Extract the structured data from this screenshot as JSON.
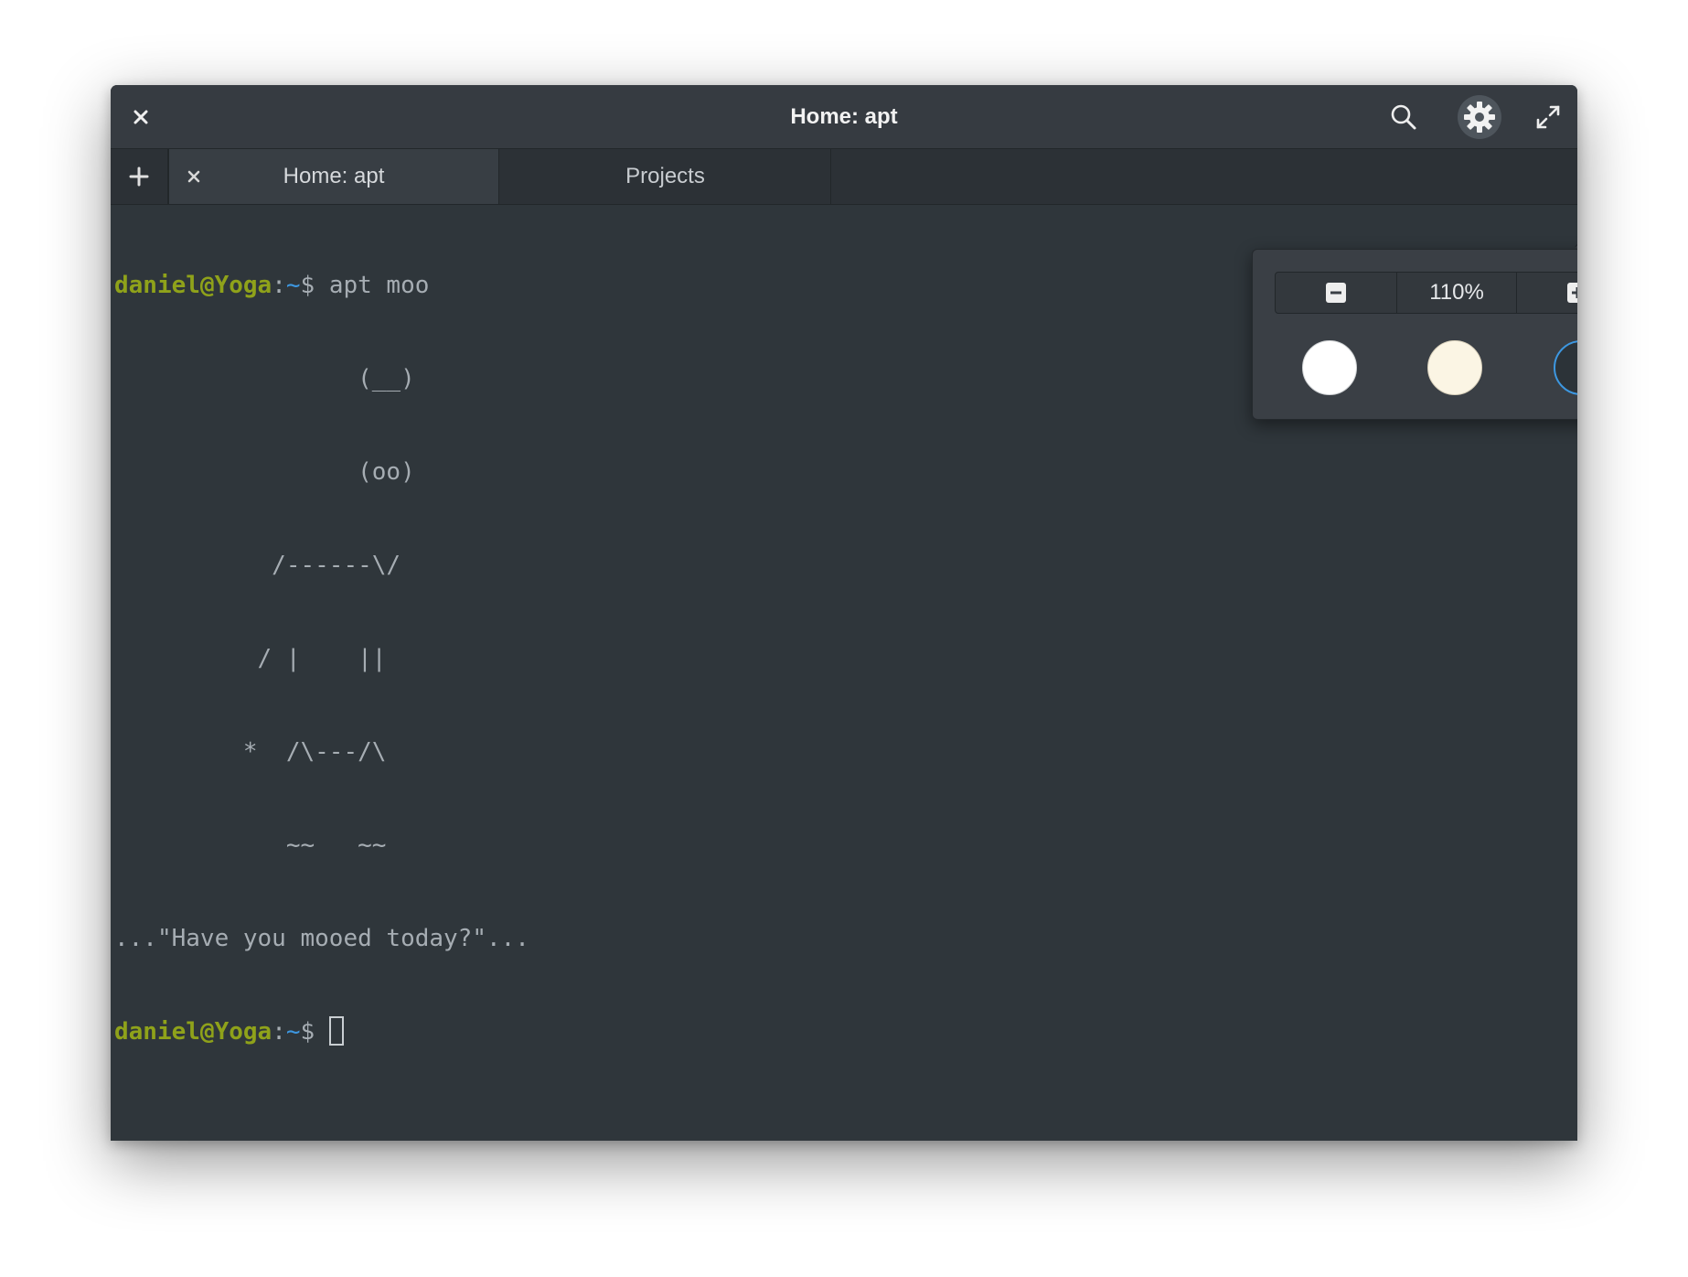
{
  "window": {
    "title": "Home: apt"
  },
  "titlebar": {
    "close_icon": "close-icon",
    "search_icon": "search-icon",
    "settings_icon": "gear-icon",
    "fullscreen_icon": "fullscreen-icon"
  },
  "tabs": [
    {
      "label": "Home: apt",
      "active": true
    },
    {
      "label": "Projects",
      "active": false
    }
  ],
  "terminal": {
    "prompt_user": "daniel@Yoga",
    "prompt_sep": ":",
    "prompt_path": "~",
    "prompt_symbol": "$ ",
    "command": "apt moo",
    "output": [
      "                 (__)",
      "                 (oo)",
      "           /------\\/",
      "          / |    ||",
      "         *  /\\---/\\",
      "            ~~   ~~",
      "...\"Have you mooed today?\"..."
    ],
    "colors": {
      "user": "#8fa21a",
      "path": "#3d97e0",
      "text": "#a6adb3",
      "background": "#2f363b"
    }
  },
  "settings_popover": {
    "zoom_level": "110%",
    "zoom_out_icon": "minus-icon",
    "zoom_in_icon": "plus-icon",
    "color_schemes": [
      {
        "name": "light",
        "color": "#ffffff",
        "selected": false
      },
      {
        "name": "sepia",
        "color": "#fbf5e4",
        "selected": false
      },
      {
        "name": "dark",
        "color": "#2c3338",
        "selected": true
      }
    ],
    "accent_color": "#3d97e0"
  }
}
